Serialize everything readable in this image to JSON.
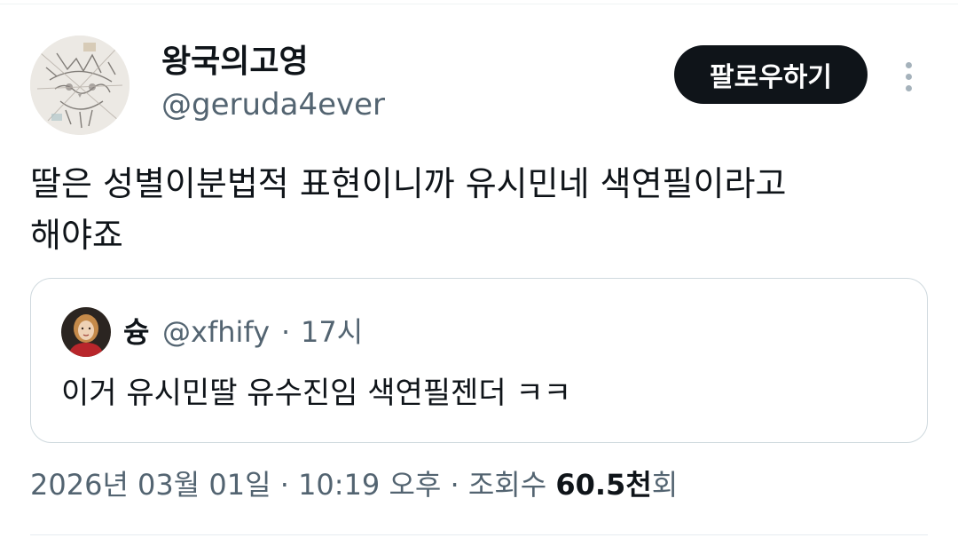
{
  "author": {
    "display_name": "왕국의고영",
    "handle": "@geruda4ever",
    "avatar_icon": "cat-sketch-avatar"
  },
  "follow_button": {
    "label": "팔로우하기"
  },
  "more_icon": "more-vertical-icon",
  "tweet": {
    "text": "딸은 성별이분법적 표현이니까 유시민네 색연필이라고\n해야죠"
  },
  "quote": {
    "display_name": "슝",
    "handle": "@xfhify",
    "separator": "·",
    "time": "17시",
    "text": "이거 유시민딸 유수진임 색연필젠더 ㅋㅋ"
  },
  "meta": {
    "date": "2026년 03월 01일",
    "sep1": " · ",
    "time": "10:19 오후",
    "sep2": " · ",
    "views_label": "조회수 ",
    "views_count": "60.5천",
    "views_suffix": "회"
  },
  "colors": {
    "text_primary": "#0f1419",
    "text_secondary": "#536471",
    "button_bg": "#0f1419",
    "border": "#cfd9de"
  }
}
